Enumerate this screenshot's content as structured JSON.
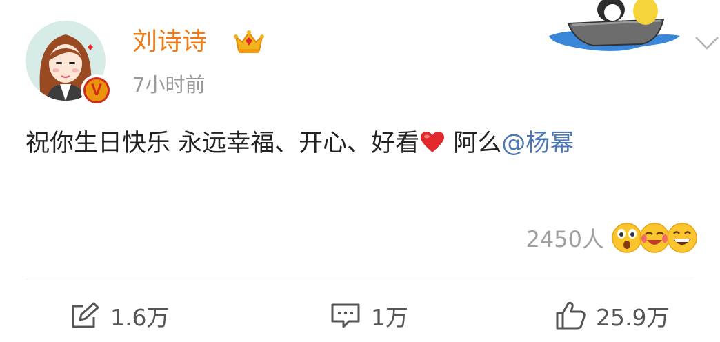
{
  "post": {
    "author": "刘诗诗",
    "time": "7小时前",
    "text_main": "祝你生日快乐 永远幸福、开心、好看",
    "text_after_heart": " 阿么",
    "mention": "@杨幂",
    "reactions_count": "2450人",
    "emojis": [
      "surprised-emoji",
      "laugh-cry-emoji",
      "grin-emoji"
    ],
    "icons": {
      "heart": "heart-icon",
      "crown": "crown-icon",
      "verified": "verified-v-icon",
      "more": "chevron-down-icon"
    }
  },
  "actions": {
    "repost": "1.6万",
    "comment": "1万",
    "like": "25.9万"
  },
  "colors": {
    "name": "#f07b16",
    "mention": "#4d78b4",
    "muted": "#9a9a9a",
    "heart": "#e0282d"
  }
}
